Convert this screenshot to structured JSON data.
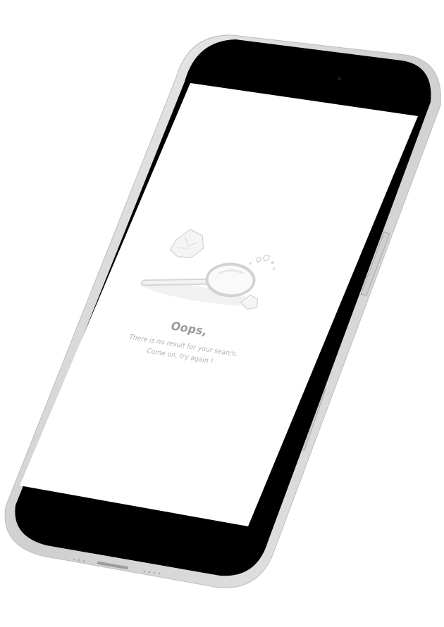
{
  "empty_state": {
    "title": "Oops,",
    "message_line1": "There is no result for your search.",
    "message_line2": "Come on, try again !",
    "illustration_icon": "magnifier-crumpled-paper-icon"
  },
  "colors": {
    "frame": "#d8d8d8",
    "bezel": "#000000",
    "screen": "#ffffff",
    "title_text": "#9a9a9a",
    "message_text": "#b3b3b3",
    "illustration": "#e6e6e6"
  }
}
